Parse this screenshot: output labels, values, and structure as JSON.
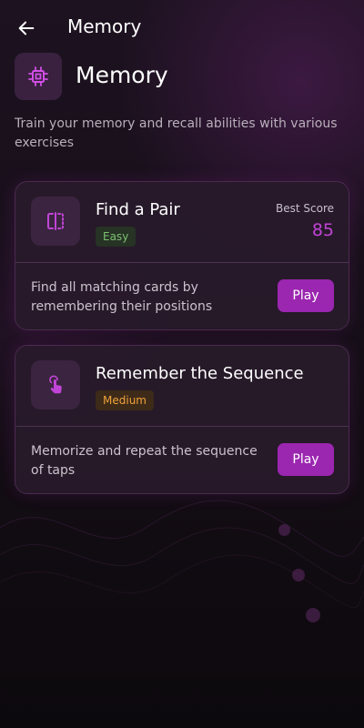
{
  "topbar": {
    "title": "Memory",
    "back_icon": "arrow-left-icon"
  },
  "header": {
    "title": "Memory",
    "icon": "chip-icon",
    "description": "Train your memory and recall abilities with various exercises"
  },
  "colors": {
    "accent": "#9b26b0",
    "score": "#c044d6",
    "easy": "#7fbf72",
    "medium": "#f0a23a"
  },
  "games": [
    {
      "title": "Find a Pair",
      "icon": "split-cards-icon",
      "difficulty": "Easy",
      "best_score_label": "Best Score",
      "best_score": "85",
      "description": "Find all matching cards by remembering their positions",
      "play_label": "Play"
    },
    {
      "title": "Remember the Sequence",
      "icon": "tap-finger-icon",
      "difficulty": "Medium",
      "description": "Memorize and repeat the sequence of taps",
      "play_label": "Play"
    }
  ]
}
